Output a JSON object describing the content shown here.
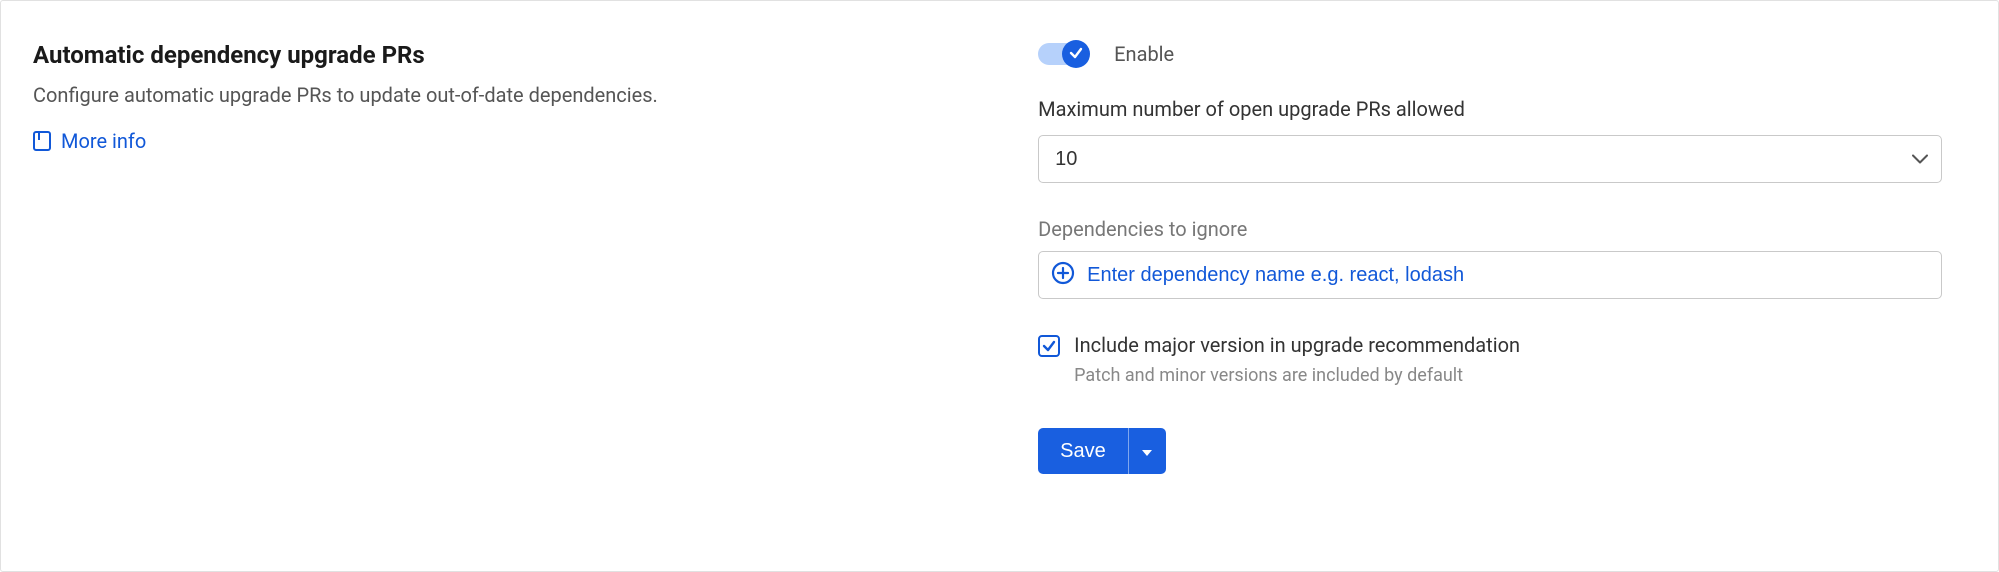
{
  "section": {
    "title": "Automatic dependency upgrade PRs",
    "description": "Configure automatic upgrade PRs to update out-of-date dependencies.",
    "more_info": "More info"
  },
  "toggle": {
    "label": "Enable",
    "enabled": true
  },
  "fields": {
    "max_prs": {
      "label": "Maximum number of open upgrade PRs allowed",
      "value": "10"
    },
    "ignore": {
      "label": "Dependencies to ignore",
      "placeholder": "Enter dependency name e.g. react, lodash"
    },
    "include_major": {
      "label": "Include major version in upgrade recommendation",
      "hint": "Patch and minor versions are included by default",
      "checked": true
    }
  },
  "actions": {
    "save": "Save"
  }
}
